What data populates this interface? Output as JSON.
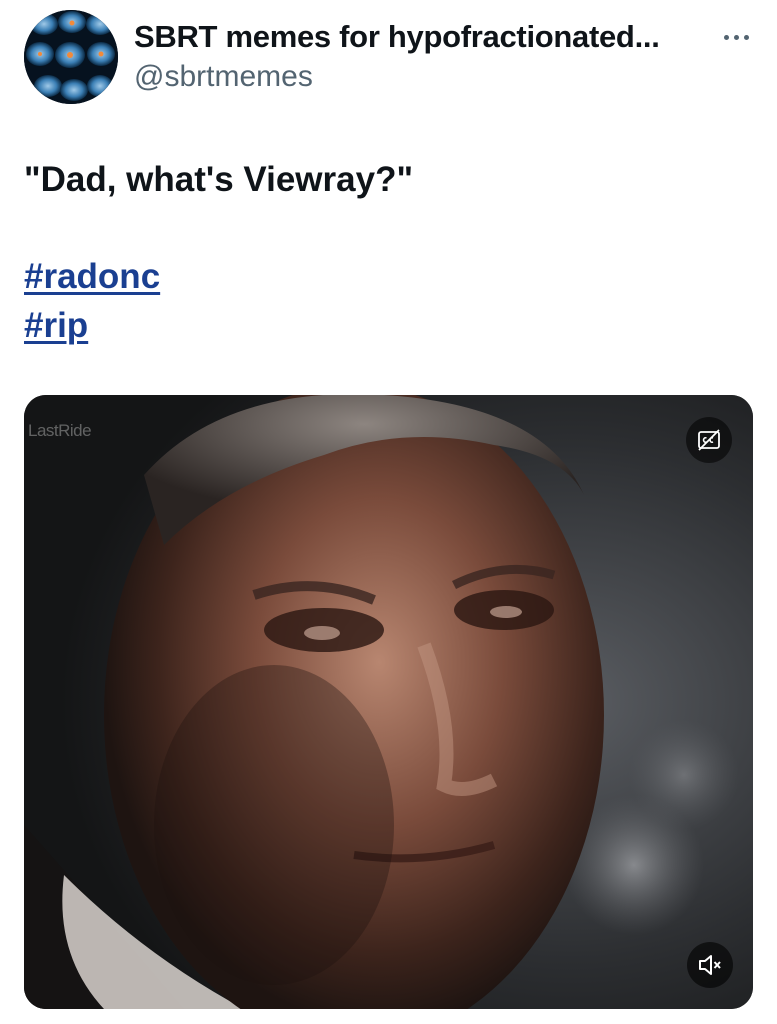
{
  "author": {
    "display_name": "SBRT memes for hypofractionated...",
    "handle": "@sbrtmemes",
    "avatar_icon": "ct-scan-avatar"
  },
  "more_icon": "more-horizontal-icon",
  "tweet": {
    "text": "\"Dad, what's Viewray?\"",
    "hashtags": [
      "#radonc",
      "#rip"
    ]
  },
  "media": {
    "type": "video",
    "watermark": "LastRide",
    "cc_icon": "closed-captions-icon",
    "mute_icon": "volume-muted-icon"
  },
  "colors": {
    "text": "#0f1419",
    "secondary_text": "#536471",
    "hashtag": "#1a3f91",
    "background": "#ffffff"
  }
}
